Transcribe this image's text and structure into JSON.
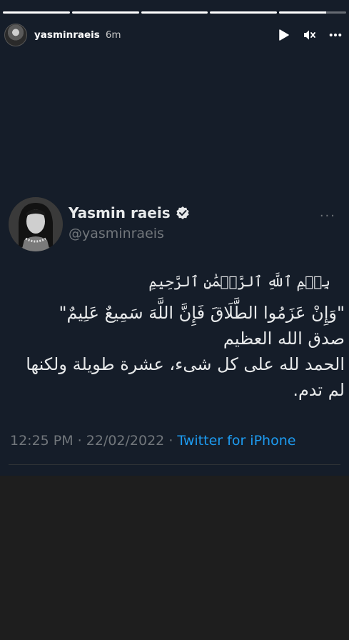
{
  "story": {
    "progress": [
      1,
      1,
      1,
      1,
      0.7
    ],
    "username": "yasminraeis",
    "time": "6m",
    "controls": {
      "play_icon": "play-icon",
      "mute_icon": "muted-speaker-icon",
      "more_icon": "more-dots-icon"
    }
  },
  "tweet": {
    "name": "Yasmin raeis",
    "handle": "@yasminraeis",
    "more": "···",
    "basmala": "بِسۡمِ ٱللَّهِ ٱلرَّحۡمَٰنِ ٱلرَّحِيمِ",
    "lines": [
      "\"وَإِنْ عَزَمُوا الطَّلَاقَ فَإِنَّ اللَّهَ سَمِيعٌ عَلِيمٌ\"",
      "صدق الله العظيم",
      "الحمد لله على كل شىء، عشرة طويلة ولكنها",
      "لم تدم."
    ],
    "timestamp": "12:25 PM · 22/02/2022 · ",
    "source": "Twitter for iPhone"
  },
  "colors": {
    "background": "#151d29",
    "link": "#1d9bf0",
    "muted": "#71767b",
    "text": "#e7e9ea"
  }
}
